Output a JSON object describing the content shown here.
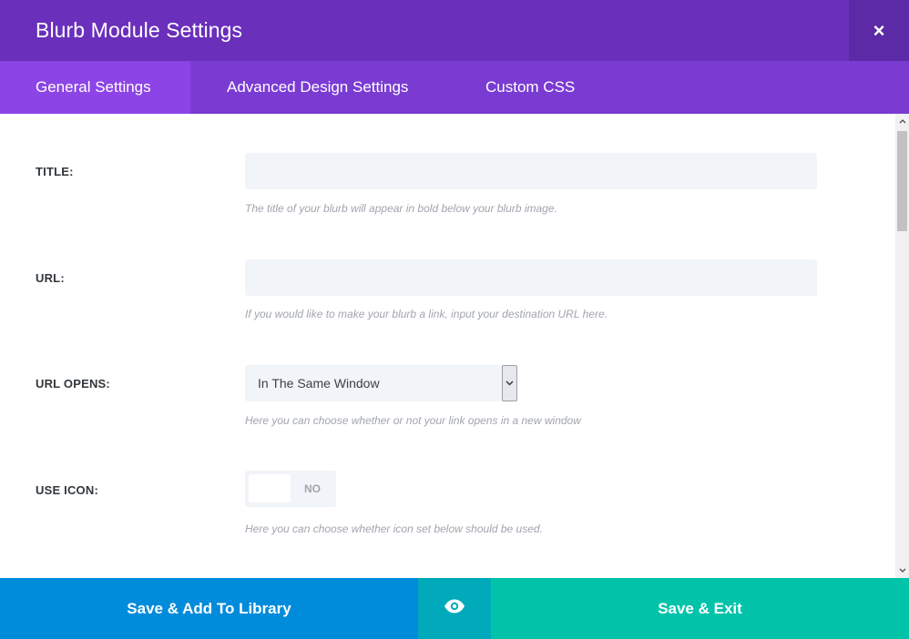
{
  "header": {
    "title": "Blurb Module Settings",
    "close_icon": "×"
  },
  "tabs": [
    {
      "label": "General Settings",
      "active": true
    },
    {
      "label": "Advanced Design Settings",
      "active": false
    },
    {
      "label": "Custom CSS",
      "active": false
    }
  ],
  "fields": {
    "title": {
      "label": "TITLE:",
      "value": "",
      "description": "The title of your blurb will appear in bold below your blurb image."
    },
    "url": {
      "label": "URL:",
      "value": "",
      "description": "If you would like to make your blurb a link, input your destination URL here."
    },
    "url_opens": {
      "label": "URL OPENS:",
      "selected": "In The Same Window",
      "description": "Here you can choose whether or not your link opens in a new window"
    },
    "use_icon": {
      "label": "USE ICON:",
      "state": "NO",
      "description": "Here you can choose whether icon set below should be used."
    }
  },
  "footer": {
    "save_library_label": "Save & Add To Library",
    "preview_icon": "eye-icon",
    "save_exit_label": "Save & Exit"
  },
  "colors": {
    "header_bg": "#6a2fbb",
    "tabs_bg": "#7a3bd3",
    "active_tab_bg": "#8c44e6",
    "library_btn": "#008bdb",
    "preview_btn": "#00aabb",
    "exit_btn": "#00c3aa"
  }
}
